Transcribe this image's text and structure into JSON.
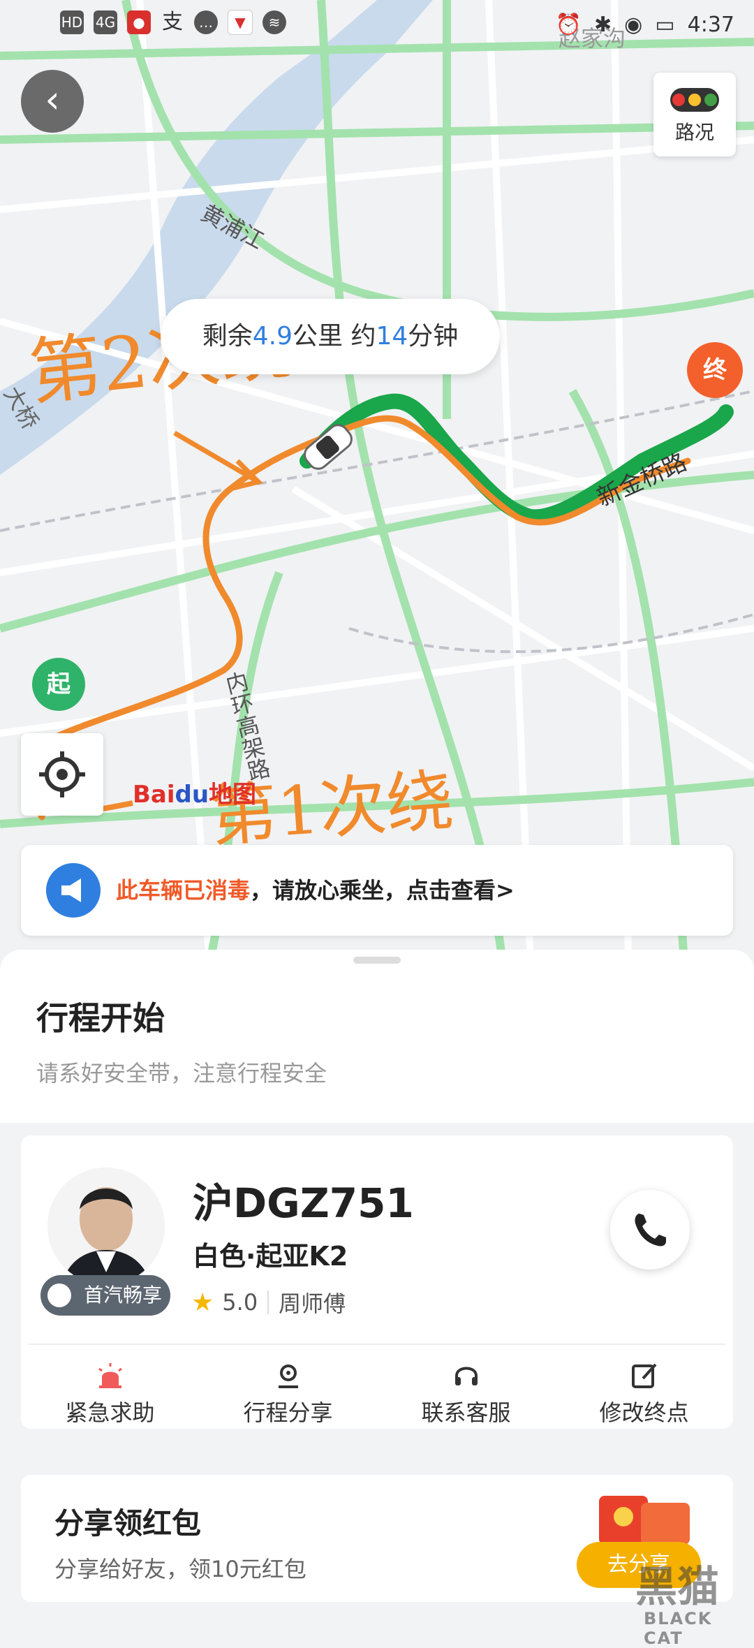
{
  "status_bar": {
    "left_icons": [
      "HD",
      "4G",
      "mic",
      "支",
      "chat",
      "pin",
      "sound"
    ],
    "time": "4:37"
  },
  "map": {
    "traffic_label": "路况",
    "eta": {
      "prefix": "剩余",
      "distance": "4.9",
      "distance_unit": "公里 约",
      "minutes": "14",
      "minutes_unit": "分钟"
    },
    "start_label": "起",
    "end_label": "终",
    "road_labels": [
      "黄浦江",
      "新金桥路",
      "内环高架路",
      "赵家沟",
      "大桥"
    ],
    "baidu_logo": {
      "text": "Bai",
      "paw": "du",
      "suffix": "地图"
    },
    "annotations": [
      "第2次绕",
      "第1次绕"
    ],
    "colors": {
      "route_green": "#1aa64a",
      "hand_drawn": "#f08a2c",
      "road_green": "#9fe0a8"
    }
  },
  "banner": {
    "highlight": "此车辆已消毒",
    "text": "，请放心乘坐，点击查看>"
  },
  "trip": {
    "title": "行程开始",
    "subtitle": "请系好安全带，注意行程安全"
  },
  "driver": {
    "brand_tag": "首汽畅享",
    "plate": "沪DGZ751",
    "car": "白色·起亚K2",
    "rating": "5.0",
    "name": "周师傅"
  },
  "actions": [
    {
      "label": "紧急求助",
      "icon": "alarm-icon"
    },
    {
      "label": "行程分享",
      "icon": "location-share-icon"
    },
    {
      "label": "联系客服",
      "icon": "headset-icon"
    },
    {
      "label": "修改终点",
      "icon": "edit-icon"
    }
  ],
  "share": {
    "title": "分享领红包",
    "subtitle": "分享给好友，领10元红包",
    "button": "去分享"
  },
  "watermark": {
    "big": "黑猫",
    "small": "BLACK CAT"
  }
}
